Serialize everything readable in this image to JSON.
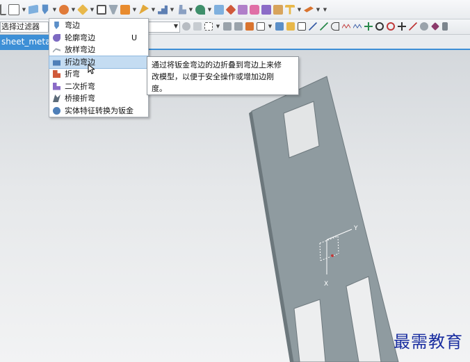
{
  "filter": {
    "value": "选择过滤器"
  },
  "tab": {
    "label": "sheet_metal"
  },
  "menu": {
    "items": [
      {
        "label": "弯边",
        "shortcut": "",
        "icon": "flange-icon"
      },
      {
        "label": "轮廓弯边",
        "shortcut": "U",
        "icon": "contour-flange-icon"
      },
      {
        "label": "放样弯边",
        "shortcut": "",
        "icon": "lofted-flange-icon"
      },
      {
        "label": "折边弯边",
        "shortcut": "",
        "icon": "hem-flange-icon"
      },
      {
        "label": "折弯",
        "shortcut": "",
        "icon": "bend-icon"
      },
      {
        "label": "二次折弯",
        "shortcut": "",
        "icon": "jog-icon"
      },
      {
        "label": "桥接折弯",
        "shortcut": "",
        "icon": "bridge-bend-icon"
      },
      {
        "label": "实体特征转换为钣金",
        "shortcut": "",
        "icon": "convert-to-sheet-metal-icon"
      }
    ],
    "highlighted_index": 3
  },
  "tooltip": {
    "line1": "通过将钣金弯边的边折叠到弯边上来修",
    "line2": "改模型，以便于安全操作或增加边刚",
    "line3": "度。"
  },
  "axes": {
    "y": "Y",
    "x": "X"
  },
  "watermark": {
    "text": "最需教育"
  },
  "colors": {
    "accent": "#3d8fd6",
    "part": "#8f9ba0",
    "highlight": "#c4dcf2"
  }
}
